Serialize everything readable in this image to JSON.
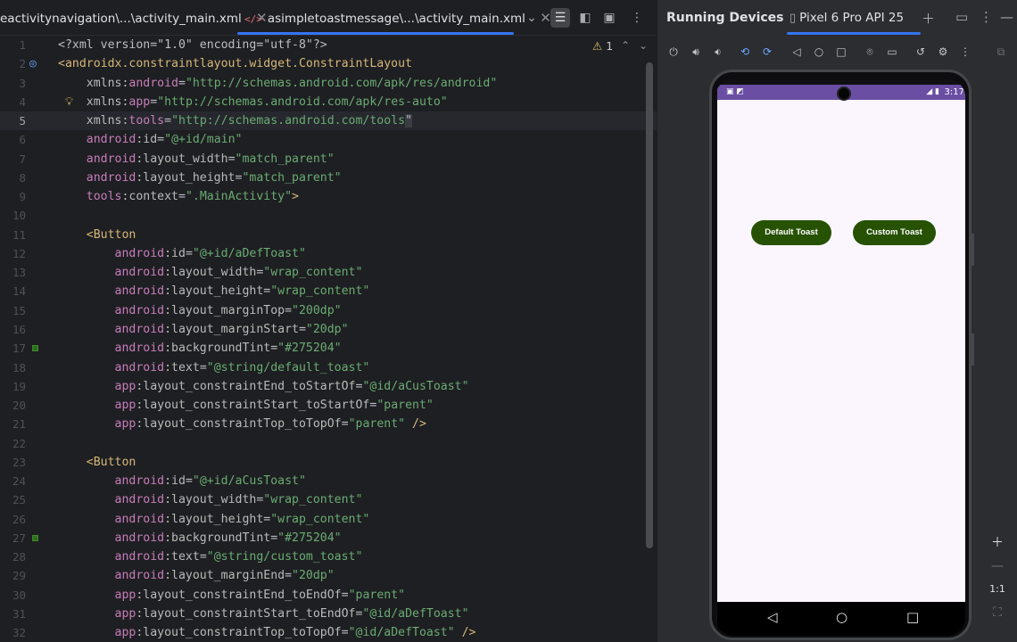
{
  "editor": {
    "tabs": [
      {
        "label": "eactivitynavigation\\...\\activity_main.xml"
      },
      {
        "label": "asimpletoastmessage\\...\\activity_main.xml"
      }
    ],
    "inspection": {
      "warnings": "1"
    },
    "lines": [
      {
        "n": "1",
        "tokens": [
          [
            "t-pi",
            "<?xml version=\"1.0\" encoding=\"utf-8\"?>"
          ]
        ]
      },
      {
        "n": "2",
        "tokens": [
          [
            "t-tag",
            "<androidx.constraintlayout.widget.ConstraintLayout"
          ]
        ]
      },
      {
        "n": "3",
        "tokens": [
          [
            "t-pun",
            "    "
          ],
          [
            "t-attr",
            "xmlns:"
          ],
          [
            "t-ns",
            "android"
          ],
          [
            "t-pun",
            "="
          ],
          [
            "t-val",
            "\"http://schemas.android.com/apk/res/android\""
          ]
        ]
      },
      {
        "n": "4",
        "tokens": [
          [
            "t-pun",
            "    "
          ],
          [
            "t-attr",
            "xmlns:"
          ],
          [
            "t-ns",
            "app"
          ],
          [
            "t-pun",
            "="
          ],
          [
            "t-val",
            "\"http://schemas.android.com/apk/res-auto\""
          ]
        ]
      },
      {
        "n": "5",
        "tokens": [
          [
            "t-pun",
            "    "
          ],
          [
            "t-attr",
            "xmlns:"
          ],
          [
            "t-ns",
            "tools"
          ],
          [
            "t-pun",
            "="
          ],
          [
            "t-val",
            "\"http://schemas.android.com/tools"
          ],
          [
            "caret-box",
            "\""
          ]
        ]
      },
      {
        "n": "6",
        "tokens": [
          [
            "t-pun",
            "    "
          ],
          [
            "t-ns",
            "android"
          ],
          [
            "t-attr",
            ":id"
          ],
          [
            "t-pun",
            "="
          ],
          [
            "t-val",
            "\"@+id/main\""
          ]
        ]
      },
      {
        "n": "7",
        "tokens": [
          [
            "t-pun",
            "    "
          ],
          [
            "t-ns",
            "android"
          ],
          [
            "t-attr",
            ":layout_width"
          ],
          [
            "t-pun",
            "="
          ],
          [
            "t-val",
            "\"match_parent\""
          ]
        ]
      },
      {
        "n": "8",
        "tokens": [
          [
            "t-pun",
            "    "
          ],
          [
            "t-ns",
            "android"
          ],
          [
            "t-attr",
            ":layout_height"
          ],
          [
            "t-pun",
            "="
          ],
          [
            "t-val",
            "\"match_parent\""
          ]
        ]
      },
      {
        "n": "9",
        "tokens": [
          [
            "t-pun",
            "    "
          ],
          [
            "t-ns",
            "tools"
          ],
          [
            "t-attr",
            ":context"
          ],
          [
            "t-pun",
            "="
          ],
          [
            "t-val",
            "\".MainActivity\""
          ],
          [
            "t-tag",
            ">"
          ]
        ]
      },
      {
        "n": "10",
        "tokens": []
      },
      {
        "n": "11",
        "tokens": [
          [
            "t-pun",
            "    "
          ],
          [
            "t-tag",
            "<Button"
          ]
        ]
      },
      {
        "n": "12",
        "tokens": [
          [
            "t-pun",
            "        "
          ],
          [
            "t-ns",
            "android"
          ],
          [
            "t-attr",
            ":id"
          ],
          [
            "t-pun",
            "="
          ],
          [
            "t-val",
            "\"@+id/aDefToast\""
          ]
        ]
      },
      {
        "n": "13",
        "tokens": [
          [
            "t-pun",
            "        "
          ],
          [
            "t-ns",
            "android"
          ],
          [
            "t-attr",
            ":layout_width"
          ],
          [
            "t-pun",
            "="
          ],
          [
            "t-val",
            "\"wrap_content\""
          ]
        ]
      },
      {
        "n": "14",
        "tokens": [
          [
            "t-pun",
            "        "
          ],
          [
            "t-ns",
            "android"
          ],
          [
            "t-attr",
            ":layout_height"
          ],
          [
            "t-pun",
            "="
          ],
          [
            "t-val",
            "\"wrap_content\""
          ]
        ]
      },
      {
        "n": "15",
        "tokens": [
          [
            "t-pun",
            "        "
          ],
          [
            "t-ns",
            "android"
          ],
          [
            "t-attr",
            ":layout_marginTop"
          ],
          [
            "t-pun",
            "="
          ],
          [
            "t-val",
            "\"200dp\""
          ]
        ]
      },
      {
        "n": "16",
        "tokens": [
          [
            "t-pun",
            "        "
          ],
          [
            "t-ns",
            "android"
          ],
          [
            "t-attr",
            ":layout_marginStart"
          ],
          [
            "t-pun",
            "="
          ],
          [
            "t-val",
            "\"20dp\""
          ]
        ]
      },
      {
        "n": "17",
        "tokens": [
          [
            "t-pun",
            "        "
          ],
          [
            "t-ns",
            "android"
          ],
          [
            "t-attr",
            ":backgroundTint"
          ],
          [
            "t-pun",
            "="
          ],
          [
            "t-val",
            "\"#275204\""
          ]
        ]
      },
      {
        "n": "18",
        "tokens": [
          [
            "t-pun",
            "        "
          ],
          [
            "t-ns",
            "android"
          ],
          [
            "t-attr",
            ":text"
          ],
          [
            "t-pun",
            "="
          ],
          [
            "t-val",
            "\"@string/default_toast\""
          ]
        ]
      },
      {
        "n": "19",
        "tokens": [
          [
            "t-pun",
            "        "
          ],
          [
            "t-ns",
            "app"
          ],
          [
            "t-attr",
            ":layout_constraintEnd_toStartOf"
          ],
          [
            "t-pun",
            "="
          ],
          [
            "t-val",
            "\"@id/aCusToast\""
          ]
        ]
      },
      {
        "n": "20",
        "tokens": [
          [
            "t-pun",
            "        "
          ],
          [
            "t-ns",
            "app"
          ],
          [
            "t-attr",
            ":layout_constraintStart_toStartOf"
          ],
          [
            "t-pun",
            "="
          ],
          [
            "t-val",
            "\"parent\""
          ]
        ]
      },
      {
        "n": "21",
        "tokens": [
          [
            "t-pun",
            "        "
          ],
          [
            "t-ns",
            "app"
          ],
          [
            "t-attr",
            ":layout_constraintTop_toTopOf"
          ],
          [
            "t-pun",
            "="
          ],
          [
            "t-val",
            "\"parent\""
          ],
          [
            "t-tag",
            " />"
          ]
        ]
      },
      {
        "n": "22",
        "tokens": []
      },
      {
        "n": "23",
        "tokens": [
          [
            "t-pun",
            "    "
          ],
          [
            "t-tag",
            "<Button"
          ]
        ]
      },
      {
        "n": "24",
        "tokens": [
          [
            "t-pun",
            "        "
          ],
          [
            "t-ns",
            "android"
          ],
          [
            "t-attr",
            ":id"
          ],
          [
            "t-pun",
            "="
          ],
          [
            "t-val",
            "\"@+id/aCusToast\""
          ]
        ]
      },
      {
        "n": "25",
        "tokens": [
          [
            "t-pun",
            "        "
          ],
          [
            "t-ns",
            "android"
          ],
          [
            "t-attr",
            ":layout_width"
          ],
          [
            "t-pun",
            "="
          ],
          [
            "t-val",
            "\"wrap_content\""
          ]
        ]
      },
      {
        "n": "26",
        "tokens": [
          [
            "t-pun",
            "        "
          ],
          [
            "t-ns",
            "android"
          ],
          [
            "t-attr",
            ":layout_height"
          ],
          [
            "t-pun",
            "="
          ],
          [
            "t-val",
            "\"wrap_content\""
          ]
        ]
      },
      {
        "n": "27",
        "tokens": [
          [
            "t-pun",
            "        "
          ],
          [
            "t-ns",
            "android"
          ],
          [
            "t-attr",
            ":backgroundTint"
          ],
          [
            "t-pun",
            "="
          ],
          [
            "t-val",
            "\"#275204\""
          ]
        ]
      },
      {
        "n": "28",
        "tokens": [
          [
            "t-pun",
            "        "
          ],
          [
            "t-ns",
            "android"
          ],
          [
            "t-attr",
            ":text"
          ],
          [
            "t-pun",
            "="
          ],
          [
            "t-val",
            "\"@string/custom_toast\""
          ]
        ]
      },
      {
        "n": "29",
        "tokens": [
          [
            "t-pun",
            "        "
          ],
          [
            "t-ns",
            "android"
          ],
          [
            "t-attr",
            ":layout_marginEnd"
          ],
          [
            "t-pun",
            "="
          ],
          [
            "t-val",
            "\"20dp\""
          ]
        ]
      },
      {
        "n": "30",
        "tokens": [
          [
            "t-pun",
            "        "
          ],
          [
            "t-ns",
            "app"
          ],
          [
            "t-attr",
            ":layout_constraintEnd_toEndOf"
          ],
          [
            "t-pun",
            "="
          ],
          [
            "t-val",
            "\"parent\""
          ]
        ]
      },
      {
        "n": "31",
        "tokens": [
          [
            "t-pun",
            "        "
          ],
          [
            "t-ns",
            "app"
          ],
          [
            "t-attr",
            ":layout_constraintStart_toEndOf"
          ],
          [
            "t-pun",
            "="
          ],
          [
            "t-val",
            "\"@id/aDefToast\""
          ]
        ]
      },
      {
        "n": "32",
        "tokens": [
          [
            "t-pun",
            "        "
          ],
          [
            "t-ns",
            "app"
          ],
          [
            "t-attr",
            ":layout_constraintTop_toTopOf"
          ],
          [
            "t-pun",
            "="
          ],
          [
            "t-val",
            "\"@id/aDefToast\""
          ],
          [
            "t-tag",
            " />"
          ]
        ]
      }
    ],
    "current_line": "5",
    "marked_lines": [
      "17",
      "27"
    ],
    "colors": {
      "string": "#6aab73",
      "tag": "#d5b778",
      "namespace": "#c77dbb",
      "background_tint": "#275204"
    }
  },
  "devices": {
    "title": "Running Devices",
    "tab_label": "Pixel 6 Pro API 25",
    "phone": {
      "status_time": "3:17",
      "buttons": {
        "default_label": "Default Toast",
        "custom_label": "Custom Toast"
      },
      "status_bar_color": "#6a4ea3",
      "button_color": "#275204"
    },
    "zoom": {
      "reset_label": "1:1"
    }
  }
}
